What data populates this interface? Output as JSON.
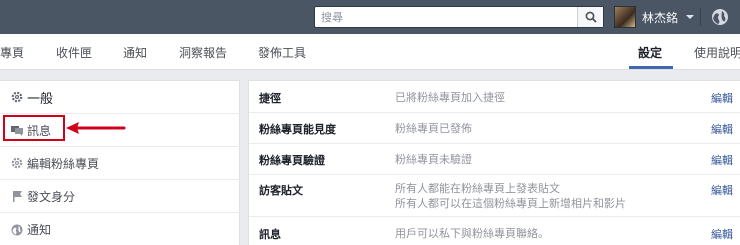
{
  "topbar": {
    "search_placeholder": "搜尋",
    "search_icon": "magnifier-icon",
    "profile_name": "林杰銘",
    "globe_icon": "globe-icon"
  },
  "tabs": [
    {
      "label": "專頁"
    },
    {
      "label": "收件匣"
    },
    {
      "label": "通知"
    },
    {
      "label": "洞察報告"
    },
    {
      "label": "發佈工具"
    },
    {
      "label": "設定",
      "active": true
    },
    {
      "label": "使用說明"
    }
  ],
  "sidebar": {
    "items": [
      {
        "label": "一般",
        "icon": "gear-icon"
      },
      {
        "label": "訊息",
        "icon": "chat-icon"
      },
      {
        "label": "編輯粉絲專頁",
        "icon": "gear-icon"
      },
      {
        "label": "發文身分",
        "icon": "flag-icon"
      },
      {
        "label": "通知",
        "icon": "globe-icon"
      }
    ]
  },
  "settings": {
    "edit_label": "編輯",
    "rows": [
      {
        "title": "捷徑",
        "value": "已將粉絲專頁加入捷徑",
        "value2": ""
      },
      {
        "title": "粉絲專頁能見度",
        "value": "粉絲專頁已發佈",
        "value2": ""
      },
      {
        "title": "粉絲專頁驗證",
        "value": "粉絲專頁未驗證",
        "value2": ""
      },
      {
        "title": "訪客貼文",
        "value": "所有人都能在粉絲專頁上發表貼文",
        "value2": "所有人都可以在這個粉絲專頁上新增相片和影片"
      },
      {
        "title": "訊息",
        "value": "用戶可以私下與粉絲專頁聯絡。",
        "value2": ""
      }
    ]
  },
  "colors": {
    "topbar": "#4b5664",
    "accent": "#4267b2",
    "link": "#365899",
    "highlight": "#d0021b"
  }
}
